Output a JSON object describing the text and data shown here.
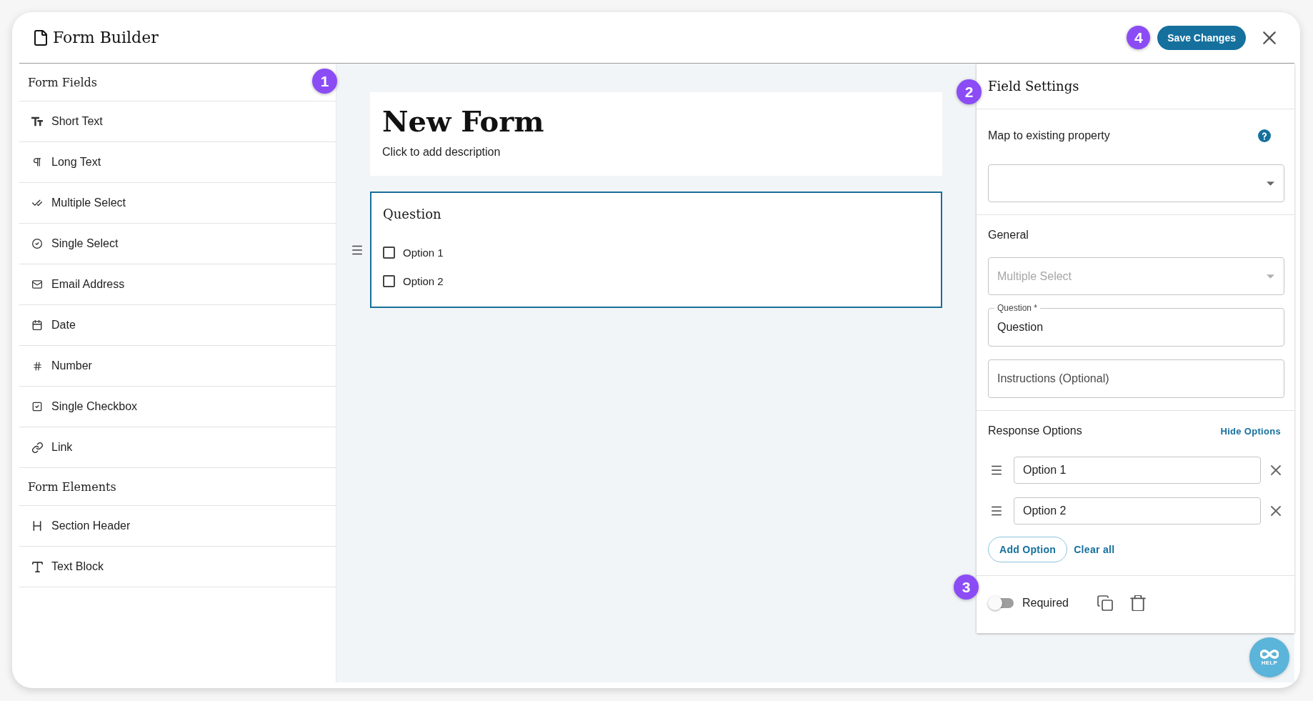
{
  "window": {
    "title": "Form Builder",
    "marker": "4",
    "save_button": "Save Changes"
  },
  "sidebar": {
    "marker": "1",
    "sections": [
      {
        "title": "Form Fields",
        "items": [
          {
            "label": "Short Text",
            "kind": "text"
          },
          {
            "label": "Long Text",
            "kind": "paragraph"
          },
          {
            "label": "Multiple Select",
            "kind": "multiselect"
          },
          {
            "label": "Single Select",
            "kind": "select"
          },
          {
            "label": "Email Address",
            "kind": "email"
          },
          {
            "label": "Date",
            "kind": "date"
          },
          {
            "label": "Number",
            "kind": "number"
          },
          {
            "label": "Single Checkbox",
            "kind": "checkbox"
          },
          {
            "label": "Link",
            "kind": "link"
          }
        ]
      },
      {
        "title": "Form Elements",
        "items": [
          {
            "label": "Section Header",
            "kind": "header"
          },
          {
            "label": "Text Block",
            "kind": "block"
          }
        ]
      }
    ]
  },
  "canvas": {
    "form": {
      "title": "New Form",
      "description": "Click to add description"
    },
    "questions": [
      {
        "title": "Question",
        "selected": true,
        "options": [
          {
            "label": "Option 1",
            "checked": false
          },
          {
            "label": "Option 2",
            "checked": false
          }
        ]
      }
    ]
  },
  "field_settings": {
    "title": "Field Settings",
    "marker": "2",
    "mapping": {
      "label": "Map to existing property"
    },
    "general": {
      "title": "General",
      "field_type": {
        "value": "Multiple Select",
        "disabled": true
      },
      "question": {
        "label": "Question *",
        "value": "Question"
      },
      "instructions": {
        "placeholder": "Instructions (Optional)"
      }
    },
    "response_options": {
      "title": "Response Options",
      "toggle_link": "Hide Options",
      "options": [
        {
          "value": "Option 1"
        },
        {
          "value": "Option 2"
        }
      ],
      "add_button": "Add Option",
      "clear_link": "Clear all"
    },
    "footer": {
      "marker": "3",
      "required": {
        "label": "Required",
        "on": false
      }
    }
  },
  "help_button": {
    "label": "HELP"
  }
}
